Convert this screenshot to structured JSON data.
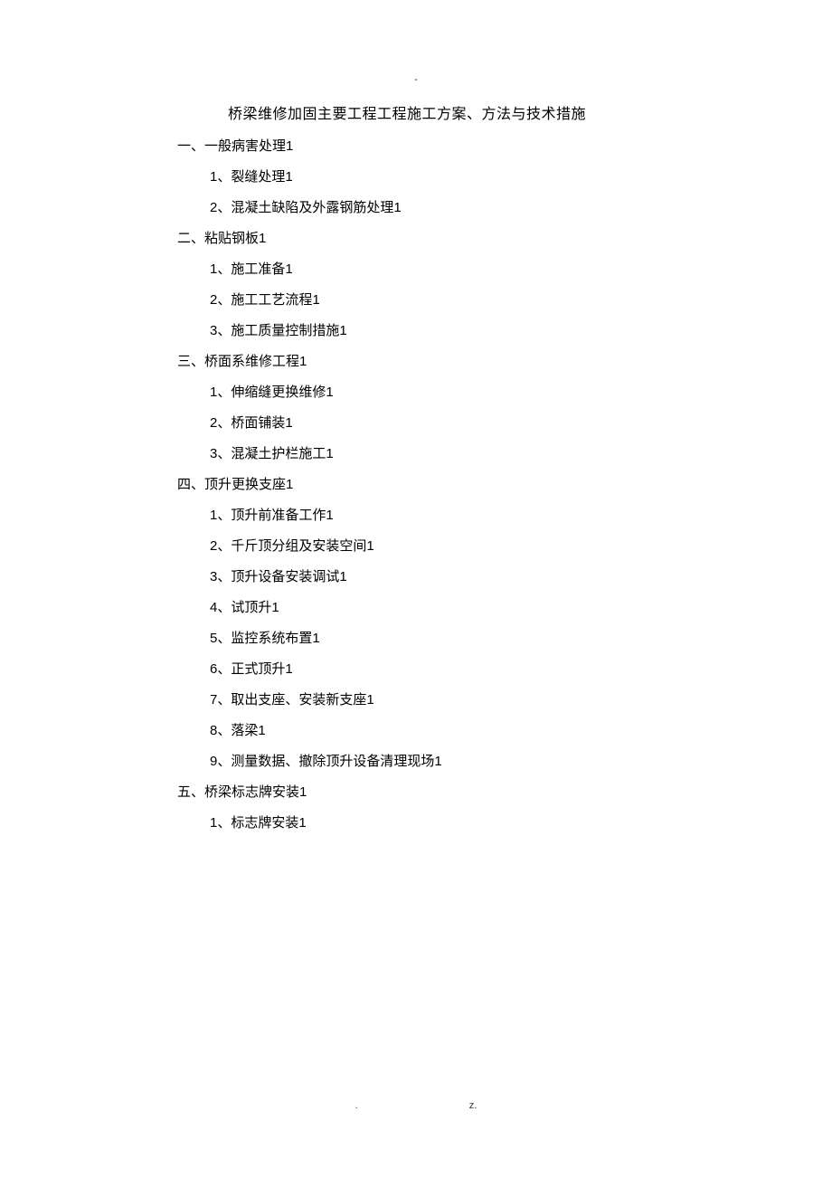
{
  "headerMark": "-",
  "title": "桥梁维修加固主要工程工程施工方案、方法与技术措施",
  "sections": [
    {
      "heading": "一、一般病害处理1",
      "items": [
        "1、裂缝处理1",
        "2、混凝土缺陷及外露钢筋处理1"
      ]
    },
    {
      "heading": "二、粘贴钢板1",
      "items": [
        "1、施工准备1",
        "2、施工工艺流程1",
        "3、施工质量控制措施1"
      ]
    },
    {
      "heading": "三、桥面系维修工程1",
      "items": [
        "1、伸缩缝更换维修1",
        "2、桥面铺装1",
        "3、混凝土护栏施工1"
      ]
    },
    {
      "heading": "四、顶升更换支座1",
      "items": [
        "1、顶升前准备工作1",
        "2、千斤顶分组及安装空间1",
        "3、顶升设备安装调试1",
        "4、试顶升1",
        "5、监控系统布置1",
        "6、正式顶升1",
        "7、取出支座、安装新支座1",
        "8、落梁1",
        "9、测量数据、撤除顶升设备清理现场1"
      ]
    },
    {
      "heading": "五、桥梁标志牌安装1",
      "items": [
        "1、标志牌安装1"
      ]
    }
  ],
  "footer": {
    "left": ".",
    "right": "z."
  }
}
